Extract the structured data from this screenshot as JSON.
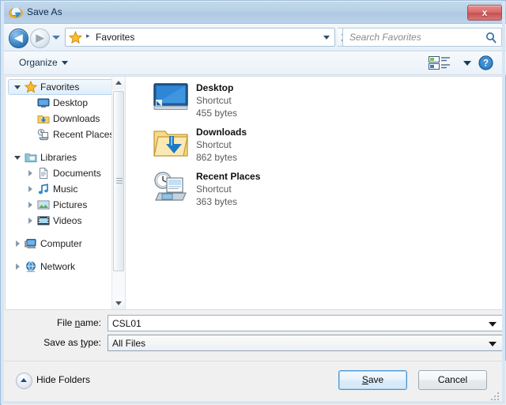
{
  "window": {
    "title": "Save As",
    "title_icon": "internet-explorer-icon",
    "close_label": "x"
  },
  "navbar": {
    "back_glyph": "◀",
    "forward_glyph": "▶",
    "breadcrumb": "Favorites",
    "breadcrumb_icon": "favorites-star-icon",
    "breadcrumb_separator": "▸",
    "search_placeholder": "Search Favorites",
    "search_icon": "search-icon",
    "refresh_icon": "refresh-icon",
    "history_icon": "chevron-down-icon"
  },
  "toolbar": {
    "organize_label": "Organize",
    "view_icon": "view-mode-icon",
    "help_icon": "help-icon",
    "help_label": "?"
  },
  "sidebar": {
    "items": [
      {
        "label": "Favorites",
        "icon": "favorites-star-icon",
        "level": 0,
        "state": "expanded",
        "selected": true
      },
      {
        "label": "Desktop",
        "icon": "desktop-icon",
        "level": 1,
        "state": "leaf",
        "selected": false
      },
      {
        "label": "Downloads",
        "icon": "downloads-icon",
        "level": 1,
        "state": "leaf",
        "selected": false
      },
      {
        "label": "Recent Places",
        "icon": "recent-places-icon",
        "level": 1,
        "state": "leaf",
        "selected": false
      },
      {
        "label": "Libraries",
        "icon": "libraries-icon",
        "level": 0,
        "state": "expanded",
        "selected": false,
        "gap_before": true
      },
      {
        "label": "Documents",
        "icon": "documents-icon",
        "level": 1,
        "state": "collapsed",
        "selected": false
      },
      {
        "label": "Music",
        "icon": "music-icon",
        "level": 1,
        "state": "collapsed",
        "selected": false
      },
      {
        "label": "Pictures",
        "icon": "pictures-icon",
        "level": 1,
        "state": "collapsed",
        "selected": false
      },
      {
        "label": "Videos",
        "icon": "videos-icon",
        "level": 1,
        "state": "collapsed",
        "selected": false
      },
      {
        "label": "Computer",
        "icon": "computer-icon",
        "level": 0,
        "state": "collapsed",
        "selected": false,
        "gap_before": true
      },
      {
        "label": "Network",
        "icon": "network-icon",
        "level": 0,
        "state": "collapsed",
        "selected": false,
        "gap_before": true
      }
    ]
  },
  "filelist": {
    "items": [
      {
        "name": "Desktop",
        "type": "Shortcut",
        "size": "455 bytes",
        "icon": "desktop-shortcut-icon"
      },
      {
        "name": "Downloads",
        "type": "Shortcut",
        "size": "862 bytes",
        "icon": "downloads-shortcut-icon"
      },
      {
        "name": "Recent Places",
        "type": "Shortcut",
        "size": "363 bytes",
        "icon": "recent-places-shortcut-icon"
      }
    ]
  },
  "form": {
    "filename_label_pre": "File ",
    "filename_label_key": "n",
    "filename_label_post": "ame:",
    "filename_value": "CSL01",
    "savetype_label_pre": "Save as ",
    "savetype_label_key": "t",
    "savetype_label_post": "ype:",
    "savetype_value": "All Files"
  },
  "footer": {
    "hide_folders_label": "Hide Folders",
    "save_label_pre": "S",
    "save_label_post": "ave",
    "cancel_label": "Cancel"
  },
  "colors": {
    "title_bar": "#b7cfe6",
    "close_button": "#d96a6a",
    "accent_blue": "#4b97d1",
    "selection_fill": "#e0eefb"
  }
}
